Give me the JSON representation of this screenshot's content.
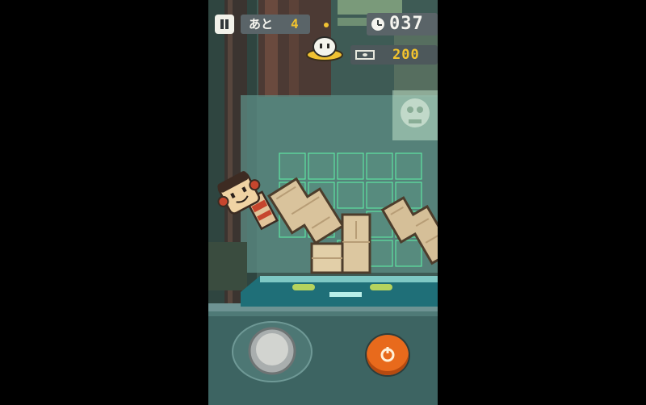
{
  "hud": {
    "remaining_label": "あと",
    "remaining_count": "4",
    "timer": "037",
    "money": "200"
  },
  "icons": [
    "pause-icon",
    "clock-icon",
    "money-icon",
    "ufo-icon",
    "jump-icon"
  ],
  "colors": {
    "background": "#000000",
    "accent_yellow": "#f2c32e",
    "jump_button": "#e86a1c",
    "grid_cells": "#5ee4a2"
  }
}
